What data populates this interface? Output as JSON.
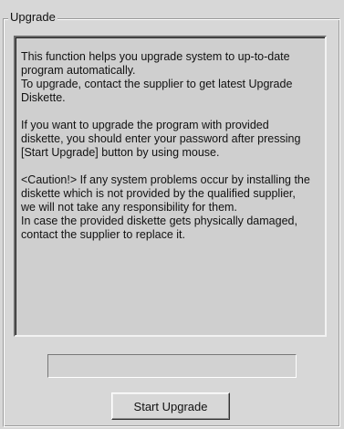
{
  "groupbox": {
    "title": "Upgrade"
  },
  "info": {
    "paragraphs": [
      "This function helps you upgrade system to up-to-date\nprogram automatically.\nTo upgrade, contact the supplier to get latest Upgrade\nDiskette.",
      "If you want to upgrade  the program with provided\ndiskette, you should enter your password after pressing\n[Start Upgrade] button by using mouse.",
      "<Caution!> If any system problems occur by installing the\ndiskette which is not provided by the qualified supplier,\nwe will not take any responsibility for them.\nIn case the provided diskette gets physically damaged,\ncontact the supplier to replace it."
    ]
  },
  "progress": {
    "value_percent": 0
  },
  "actions": {
    "start_label": "Start Upgrade"
  },
  "colors": {
    "background": "#d7d7d7",
    "textbox_background": "#cfcfcf"
  }
}
